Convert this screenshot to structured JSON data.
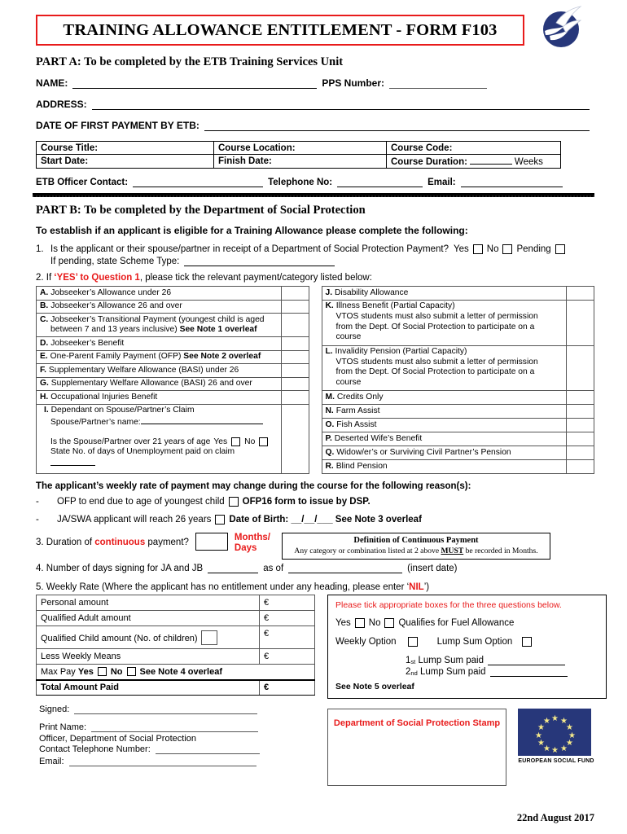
{
  "header": {
    "title": "TRAINING ALLOWANCE ENTITLEMENT - FORM F103",
    "title_border_color": "#e81b1b",
    "logo_name": "dove-logo"
  },
  "part_a": {
    "heading": "PART A: To be completed by the ETB Training Services Unit",
    "name_label": "NAME:",
    "pps_label": "PPS Number:",
    "address_label": "ADDRESS:",
    "first_payment_label": "DATE OF FIRST PAYMENT BY ETB:",
    "course_table": {
      "row1": [
        "Course Title:",
        "Course Location:",
        "Course Code:"
      ],
      "row2": [
        "Start Date:",
        "Finish Date:",
        "Course Duration:"
      ],
      "duration_unit": "Weeks"
    },
    "officer_label": "ETB Officer Contact:",
    "telephone_label": "Telephone No:",
    "email_label": "Email:"
  },
  "part_b": {
    "heading": "PART B: To be completed by the Department of Social Protection",
    "establish": "To establish if an applicant is eligible for a Training Allowance please complete the following:",
    "q1": {
      "number": "1.",
      "text": "Is the applicant or their spouse/partner in receipt of a Department of Social Protection Payment?",
      "yes": "Yes",
      "no": "No",
      "pending": "Pending",
      "sub": "If pending, state Scheme Type:"
    },
    "q2": {
      "number": "2.",
      "prefix": "If ",
      "emphasis": "‘YES’ to Question 1",
      "suffix": ", please tick the relevant payment/category listed below:"
    },
    "categories_left": [
      {
        "letter": "A.",
        "text": "Jobseeker’s Allowance under 26"
      },
      {
        "letter": "B.",
        "text": "Jobseeker’s Allowance 26 and over"
      },
      {
        "letter": "C.",
        "text": "Jobseeker’s Transitional Payment (youngest child is  aged",
        "line2": "between 7 and 13 years inclusive)",
        "bold2": "See Note 1 overleaf"
      },
      {
        "letter": "D.",
        "text": "Jobseeker’s Benefit"
      },
      {
        "letter": "E.",
        "text": "One-Parent Family Payment (OFP)",
        "bold2": "See Note 2 overleaf"
      },
      {
        "letter": "F.",
        "text": "Supplementary Welfare  Allowance (BASI) under 26"
      },
      {
        "letter": "G.",
        "text": "Supplementary Welfare  Allowance (BASI) 26 and over"
      },
      {
        "letter": "H.",
        "text": "Occupational Injuries Benefit"
      }
    ],
    "category_i": {
      "letter": "I.",
      "text": "Dependant on Spouse/Partner’s Claim",
      "spouse_name_label": "Spouse/Partner’s name:",
      "over21_label": "Is the Spouse/Partner over 21 years of age",
      "yes": "Yes",
      "no": "No",
      "days_label": "State No. of days of Unemployment paid on claim"
    },
    "categories_right": [
      {
        "letter": "J.",
        "text": "Disability Allowance"
      },
      {
        "letter": "K.",
        "text": "Illness Benefit (Partial Capacity)",
        "lines": [
          "VTOS students must also submit a letter of permission",
          "from the Dept. Of Social Protection  to participate on a",
          "course"
        ]
      },
      {
        "letter": "L.",
        "text": "Invalidity Pension (Partial Capacity)",
        "lines": [
          "VTOS students must also submit a letter of permission",
          "from the Dept. Of Social Protection  to participate on a",
          "course"
        ]
      },
      {
        "letter": "M.",
        "text": "Credits Only"
      },
      {
        "letter": "N.",
        "text": "Farm Assist"
      },
      {
        "letter": "O.",
        "text": "Fish Assist"
      },
      {
        "letter": "P.",
        "text": "Deserted Wife’s Benefit"
      },
      {
        "letter": "Q.",
        "text": "Widow/er’s or Surviving Civil Partner’s Pension"
      },
      {
        "letter": "R.",
        "text": "Blind Pension"
      }
    ],
    "reasons_heading": "The applicant’s weekly rate of payment may change during the course for the following reason(s):",
    "reason1": {
      "dash": "-",
      "text": "OFP to end due to age of youngest child",
      "bold": "OFP16 form to issue by DSP."
    },
    "reason2": {
      "dash": "-",
      "text": "JA/SWA applicant will reach 26 years",
      "bold": "Date of Birth:  __/__/___  See Note 3 overleaf"
    },
    "q3": {
      "number": "3.",
      "prefix": "Duration of ",
      "emphasis": "continuous",
      "suffix": " payment?",
      "unit_line1": "Months/",
      "unit_line2": "Days",
      "def_title": "Definition of Continuous Payment",
      "def_pre": "Any category or combination listed at 2 above ",
      "def_must": "MUST",
      "def_post": " be recorded in Months."
    },
    "q4": {
      "number": "4.",
      "text": "Number of days signing for JA and JB",
      "as_of": "as of",
      "insert_date": "(insert date)"
    },
    "q5": {
      "number": "5.",
      "prefix": "Weekly Rate (Where the applicant has no entitlement under any heading, please enter ‘",
      "nil": "NIL",
      "suffix": "’)"
    },
    "weekly_rate": [
      {
        "label": "Personal amount",
        "currency": "€"
      },
      {
        "label": "Qualified Adult amount",
        "currency": "€"
      },
      {
        "label": "Qualified Child amount (No. of children)",
        "currency": "€",
        "has_box": true
      },
      {
        "label": "Less Weekly Means",
        "currency": "€"
      }
    ],
    "max_pay": {
      "label": "Max Pay",
      "yes": "Yes",
      "no": "No",
      "note": "See Note 4 overleaf"
    },
    "total": {
      "label": "Total Amount Paid",
      "currency": "€"
    },
    "fuel": {
      "tip": "Please tick appropriate boxes for the three questions below.",
      "yes": "Yes",
      "no": "No",
      "qualifies": "Qualifies for Fuel Allowance",
      "weekly_option": "Weekly Option",
      "lump_sum_option": "Lump Sum Option",
      "lump1_num": "1",
      "lump1_sup": "st",
      "lump1_text": "Lump Sum paid",
      "lump2_num": "2",
      "lump2_sup": "nd",
      "lump2_text": "Lump Sum paid",
      "note5": "See Note 5 overleaf"
    },
    "signature": {
      "signed": "Signed:",
      "print_name": "Print Name:",
      "officer": "Officer, Department of Social Protection",
      "contact": "Contact Telephone Number:",
      "email": "Email:"
    },
    "stamp_text": "Department of Social Protection Stamp",
    "eu": {
      "label": "EUROPEAN SOCIAL FUND",
      "flag_color": "#27377a",
      "star_color": "#f5e98a"
    }
  },
  "footer": {
    "date": "22nd August 2017"
  }
}
